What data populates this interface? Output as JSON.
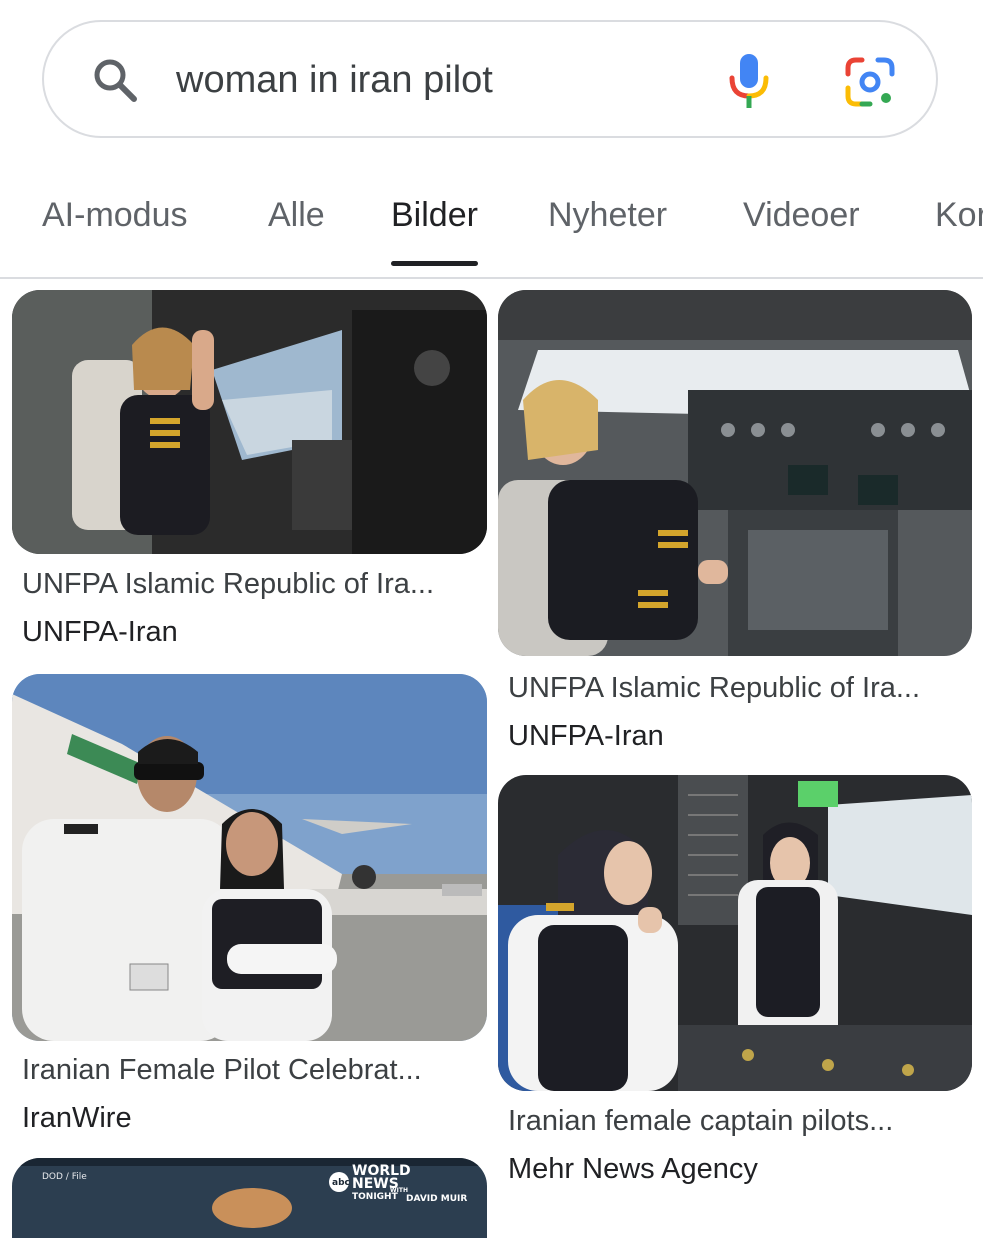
{
  "search": {
    "query": "woman in iran pilot",
    "icons": [
      "search-icon",
      "mic-icon",
      "google-lens-icon"
    ]
  },
  "tabs": [
    {
      "label": "AI-modus",
      "active": false
    },
    {
      "label": "Alle",
      "active": false
    },
    {
      "label": "Bilder",
      "active": true
    },
    {
      "label": "Nyheter",
      "active": false
    },
    {
      "label": "Videoer",
      "active": false
    },
    {
      "label": "Kor",
      "active": false
    }
  ],
  "results": [
    {
      "title": "UNFPA Islamic Republic of Ira...",
      "source": "UNFPA-Iran"
    },
    {
      "title": "UNFPA Islamic Republic of Ira...",
      "source": "UNFPA-Iran"
    },
    {
      "title": "Iranian Female Pilot Celebrat...",
      "source": "IranWire"
    },
    {
      "title": "Iranian female captain pilots...",
      "source": "Mehr News Agency"
    }
  ],
  "partial_result": {
    "corner_label": "DOD / File",
    "logo_abc": "abc",
    "logo_world": "WORLD",
    "logo_news": "NEWS",
    "logo_tonight": "TONIGHT",
    "logo_with": "WITH",
    "logo_name": "DAVID MUIR"
  },
  "colors": {
    "accent_blue": "#4285F4",
    "accent_red": "#EA4335",
    "accent_yellow": "#FBBC05",
    "accent_green": "#34A853",
    "divider": "#dadce0"
  }
}
